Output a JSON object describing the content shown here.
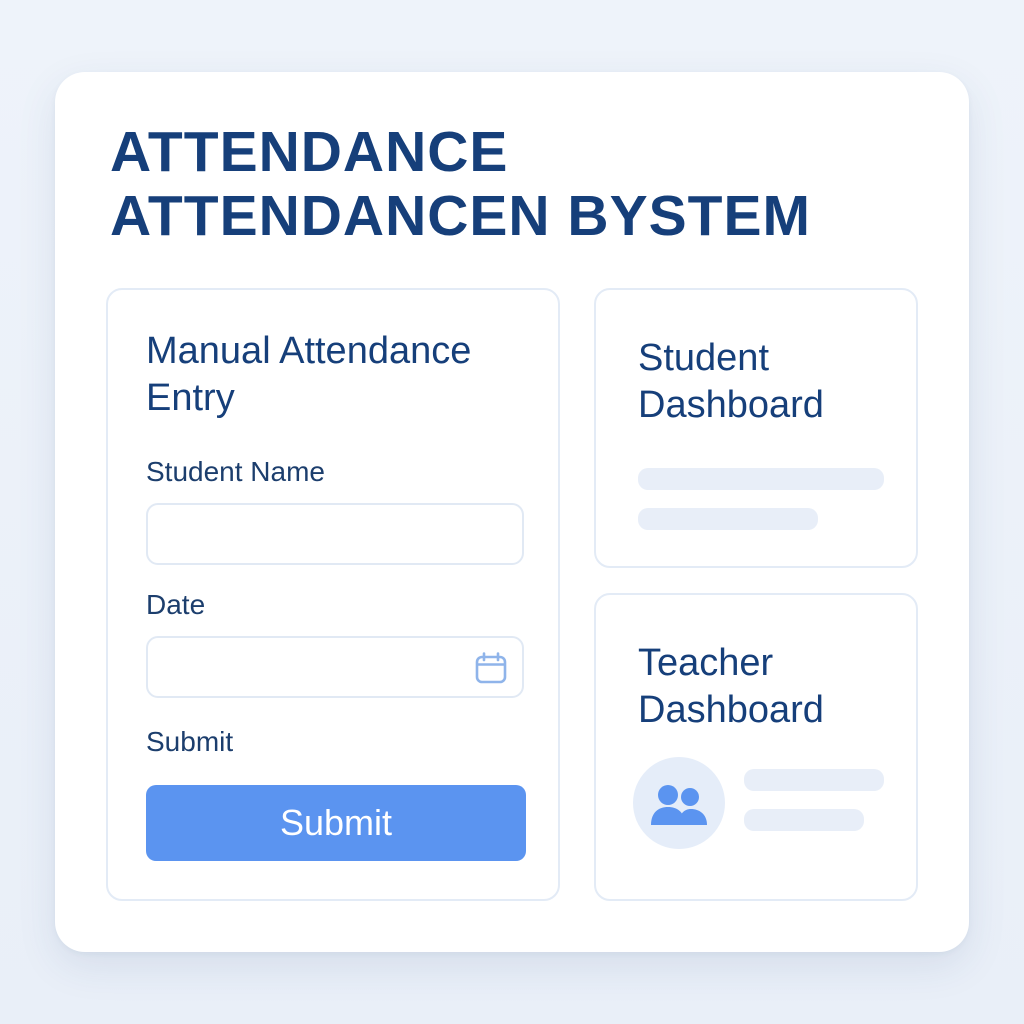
{
  "app": {
    "title_line1": "ATTENDANCE",
    "title_line2": "ATTENDANCEN ΒYSTEM"
  },
  "manual_entry": {
    "title_line1": "Manual Attendance",
    "title_line2": "Entry",
    "student_name_label": "Student Name",
    "student_name_value": "",
    "date_label": "Date",
    "date_value": "",
    "date_icon": "calendar-icon",
    "submit_label": "Submit",
    "submit_button": "Submit"
  },
  "student_dashboard": {
    "title_line1": "Student",
    "title_line2": "Dashboard"
  },
  "teacher_dashboard": {
    "title_line1": "Teacher",
    "title_line2": "Dashboard",
    "avatar_icon": "users-icon"
  },
  "colors": {
    "page_background": "#eef3fa",
    "card": "#ffffff",
    "title": "#163f7a",
    "panel_border": "#e3ebf6",
    "accent_button": "#5b94f0",
    "skeleton": "#e8eef8",
    "icon": "#5b94f0",
    "avatar_bg": "#e5edf9"
  }
}
